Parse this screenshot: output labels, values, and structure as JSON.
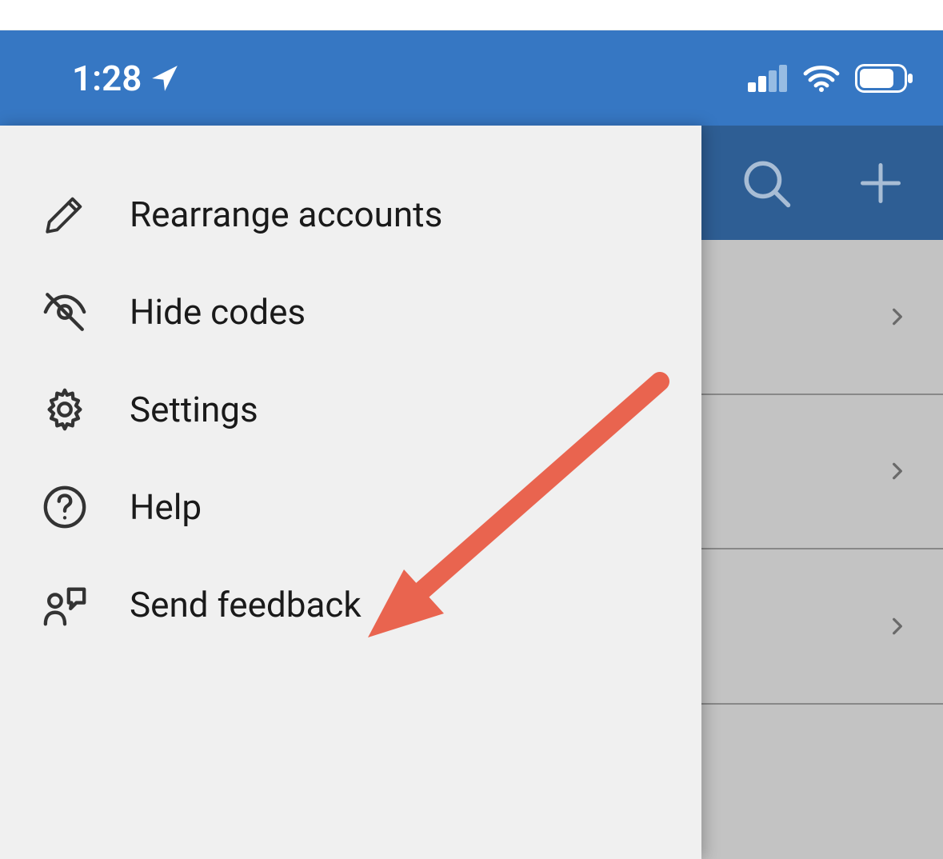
{
  "statusBar": {
    "time": "1:28"
  },
  "backgroundHeader": {
    "searchIcon": "search",
    "addIcon": "plus"
  },
  "menu": {
    "items": [
      {
        "icon": "pencil",
        "label": "Rearrange accounts"
      },
      {
        "icon": "eye-off",
        "label": "Hide codes"
      },
      {
        "icon": "gear",
        "label": "Settings"
      },
      {
        "icon": "help-circle",
        "label": "Help"
      },
      {
        "icon": "feedback",
        "label": "Send feedback"
      }
    ]
  },
  "colors": {
    "statusBarBlue": "#3677C3",
    "bgHeaderBlue": "#2E5E94",
    "panelGray": "#F0F0F0",
    "arrowRed": "#E9644F"
  }
}
